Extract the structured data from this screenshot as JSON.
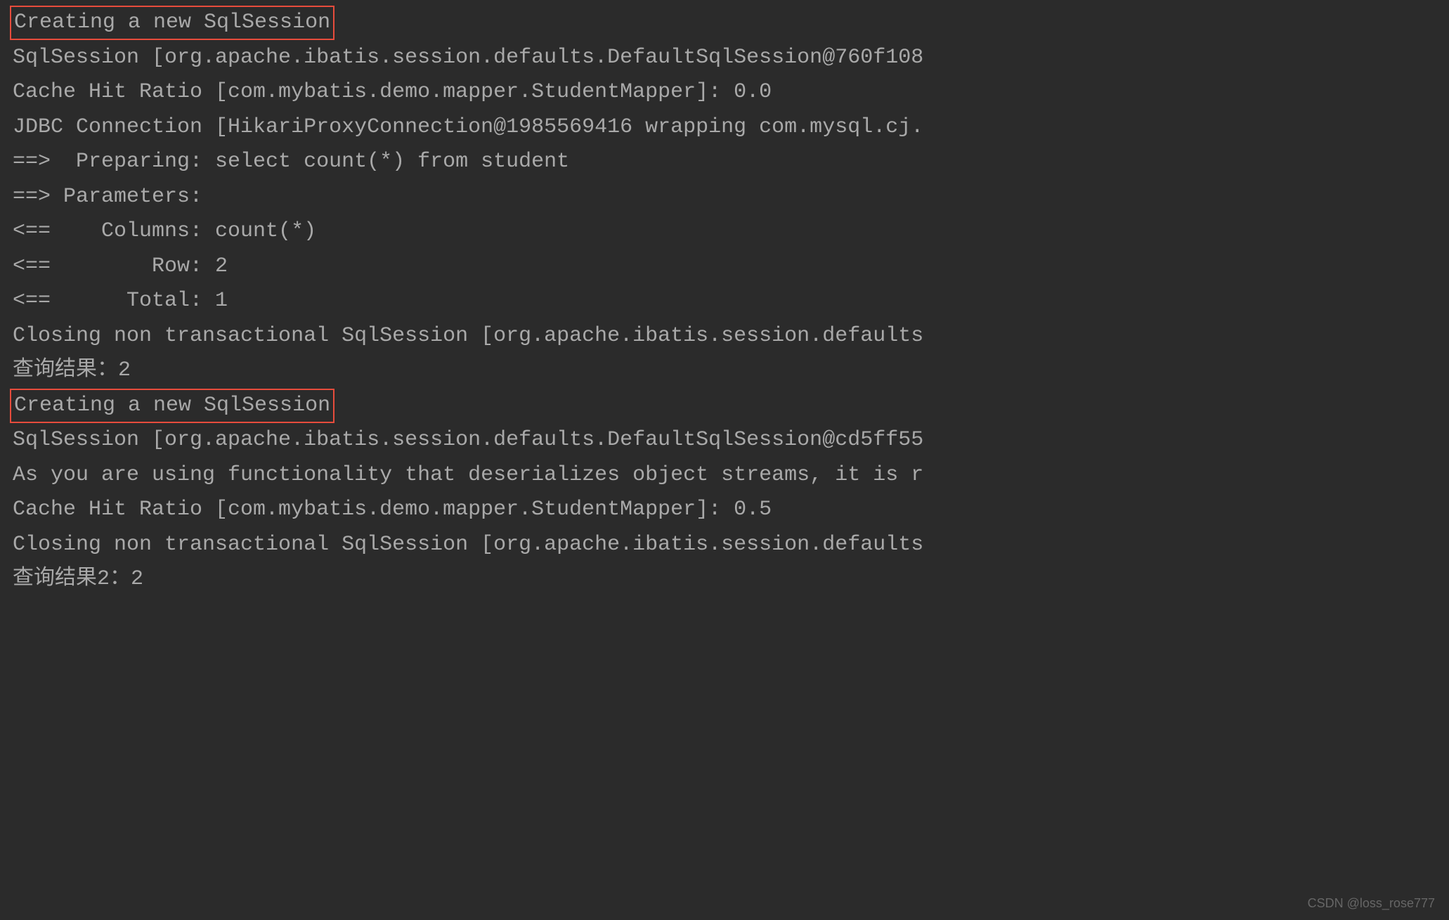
{
  "lines": {
    "l0": "Creating a new SqlSession",
    "l1": "SqlSession [org.apache.ibatis.session.defaults.DefaultSqlSession@760f108",
    "l2": "Cache Hit Ratio [com.mybatis.demo.mapper.StudentMapper]: 0.0",
    "l3": "JDBC Connection [HikariProxyConnection@1985569416 wrapping com.mysql.cj.",
    "l4": "==>  Preparing: select count(*) from student",
    "l5": "==> Parameters:",
    "l6": "<==    Columns: count(*)",
    "l7": "<==        Row: 2",
    "l8": "<==      Total: 1",
    "l9": "Closing non transactional SqlSession [org.apache.ibatis.session.defaults",
    "l10": "查询结果：2",
    "l11": "Creating a new SqlSession",
    "l12": "SqlSession [org.apache.ibatis.session.defaults.DefaultSqlSession@cd5ff55",
    "l13": "As you are using functionality that deserializes object streams, it is r",
    "l14": "Cache Hit Ratio [com.mybatis.demo.mapper.StudentMapper]: 0.5",
    "l15": "Closing non transactional SqlSession [org.apache.ibatis.session.defaults",
    "l16": "查询结果2：2"
  },
  "watermark": "CSDN @loss_rose777"
}
